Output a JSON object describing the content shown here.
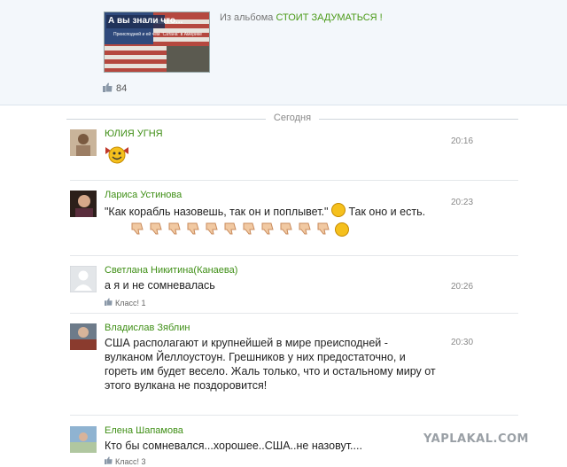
{
  "post": {
    "image_text_1": "А вы знали что...",
    "image_text_2": "Преисподней и ей чем \"Сатана\" в Америке",
    "album_prefix": "Из альбома",
    "album_name": "СТОИТ ЗАДУМАТЬСЯ !",
    "likes": "84"
  },
  "separator": "Сегодня",
  "comments": [
    {
      "author": "ЮЛИЯ УГНЯ",
      "text": "",
      "time": "20:16"
    },
    {
      "author": "Лариса Устинова",
      "text_a": "\"Как корабль назовешь, так он и поплывет.\"",
      "text_b": "Так оно и есть.",
      "time": "20:23"
    },
    {
      "author": "Светлана Никитина(Канаева)",
      "text": "а я и не сомневалась",
      "time": "20:26",
      "klass": "Класс! 1"
    },
    {
      "author": "Владислав Зяблин",
      "text": "США располагают и крупнейшей в мире преисподней - вулканом Йеллоустоун. Грешников у них предостаточно, и гореть им будет весело. Жаль только, что и остальному миру от этого вулкана не поздоровится!",
      "time": "20:30"
    },
    {
      "author": "Елена Шапамова",
      "text": "Кто бы сомневался...хорошее..США..не назовут....",
      "klass": "Класс! 3"
    }
  ],
  "watermark": "YAPLAKAL.COM",
  "colors": {
    "link_green": "#3f8f16",
    "panel_bg": "#f3f7fb"
  }
}
